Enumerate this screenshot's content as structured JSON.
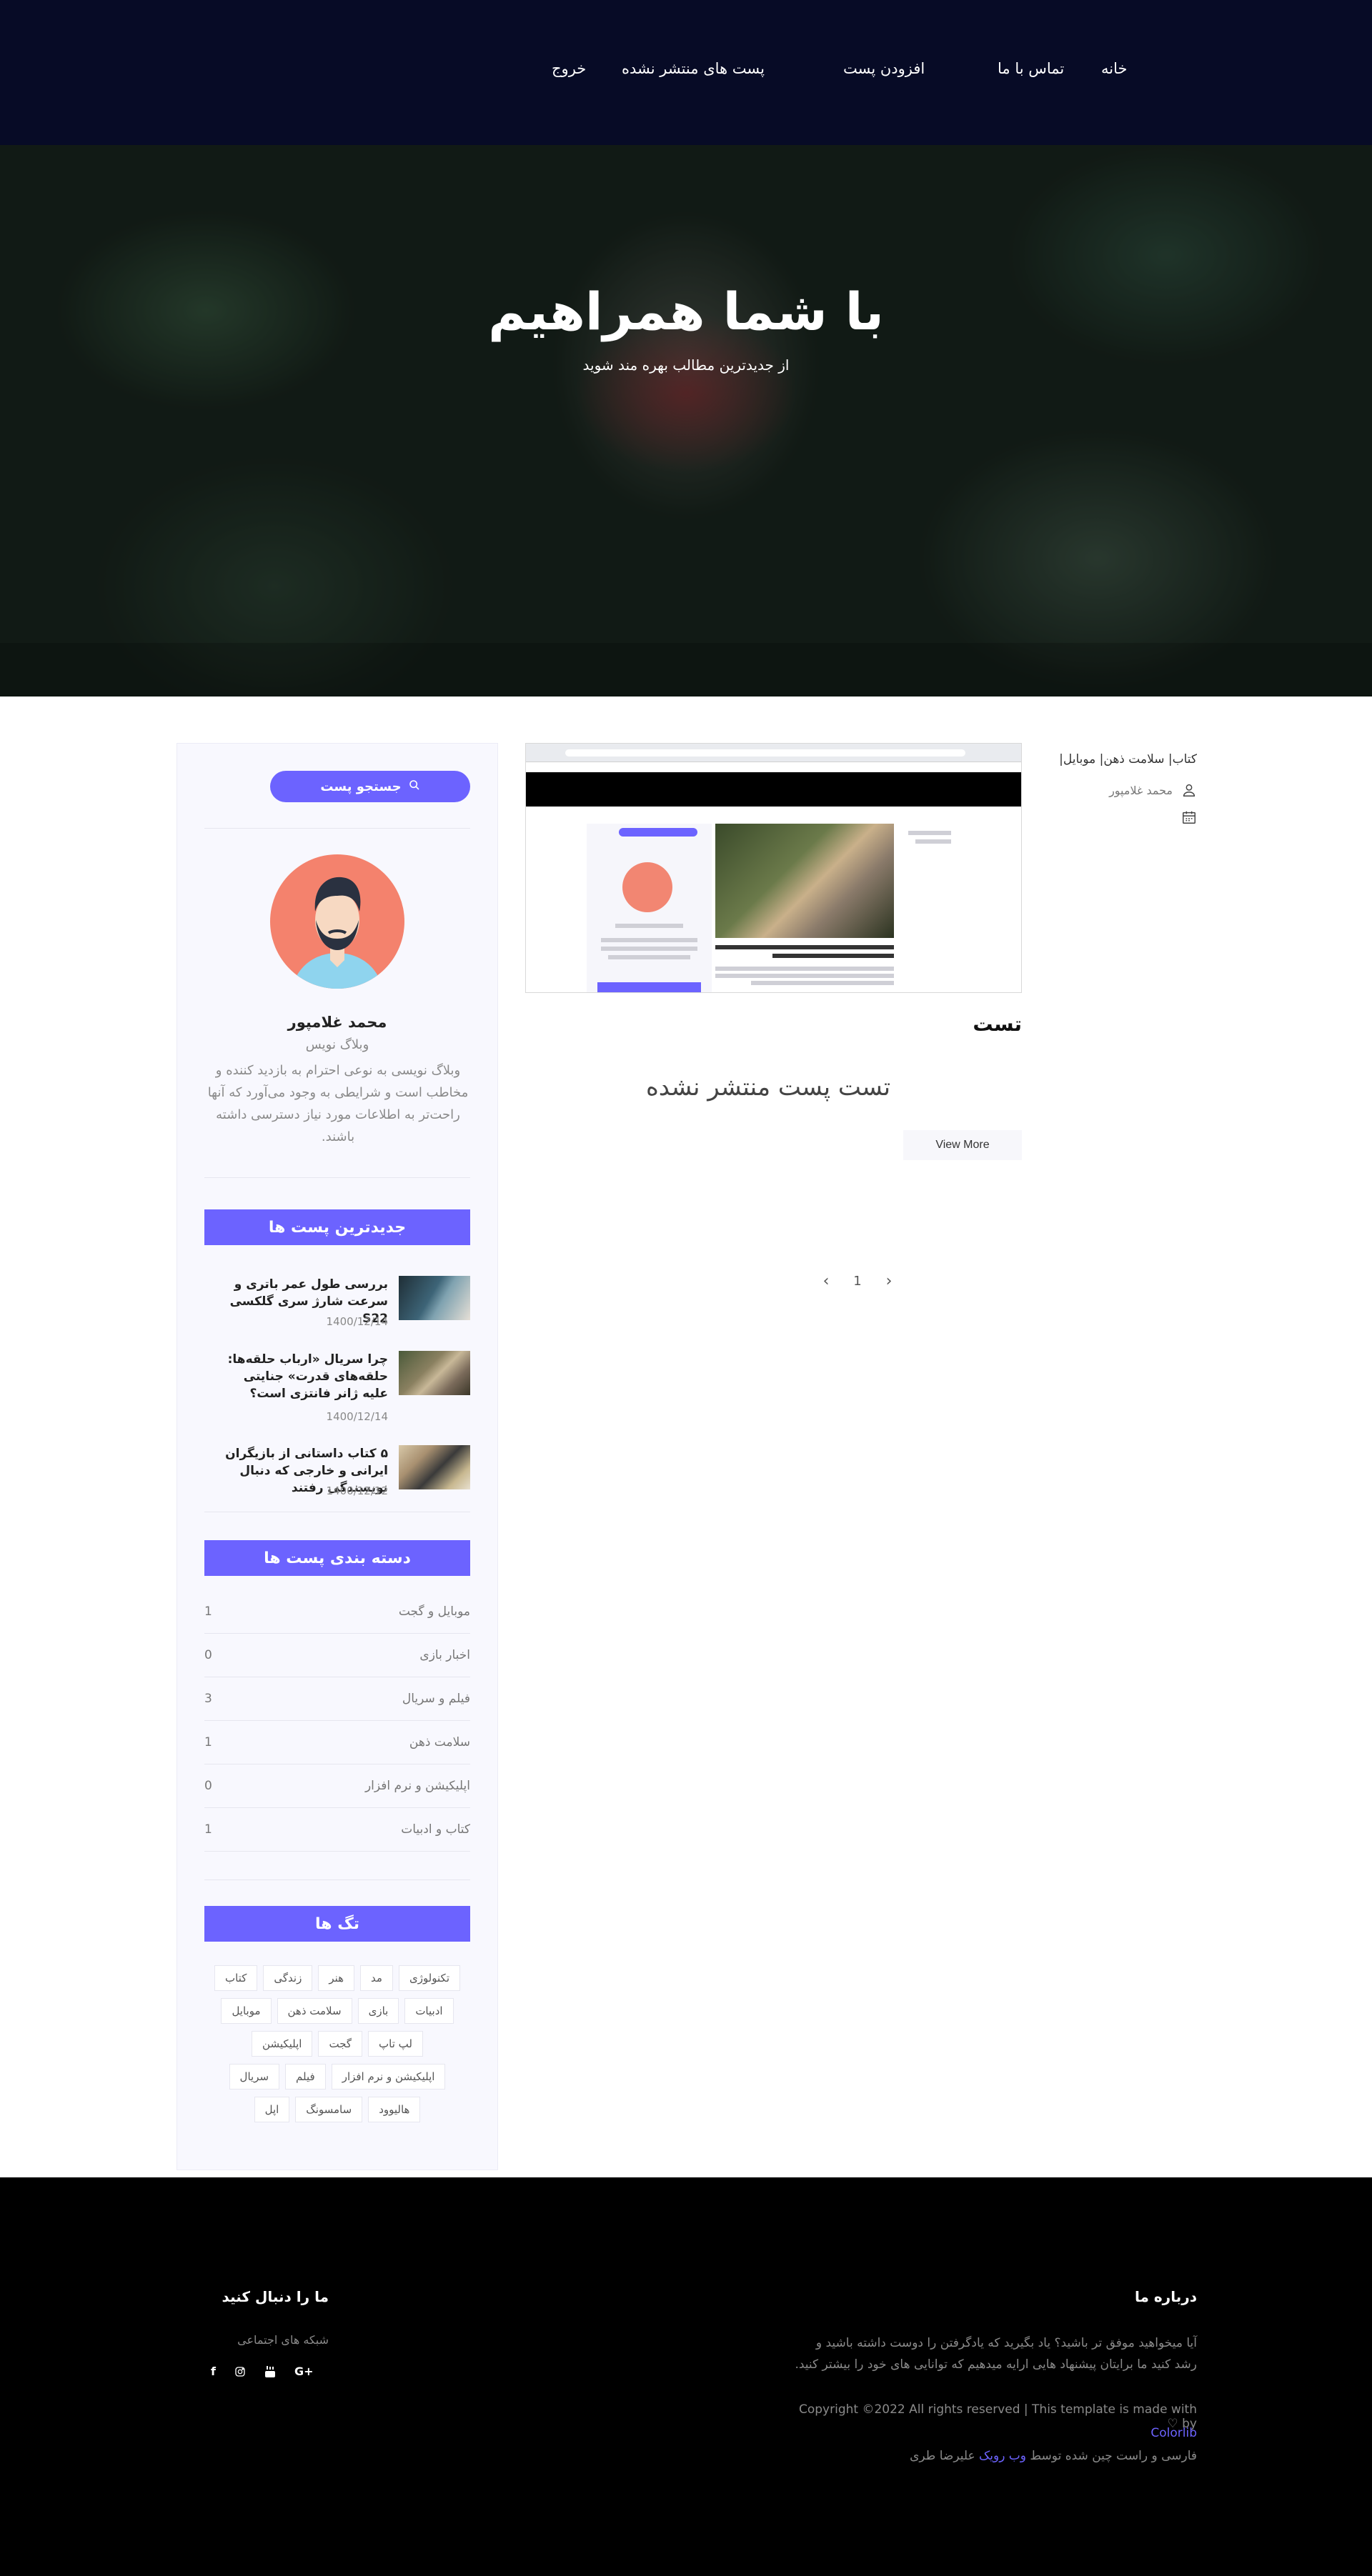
{
  "nav": {
    "items": [
      {
        "label": "خانه"
      },
      {
        "label": "تماس با ما"
      },
      {
        "label": "افزودن پست"
      },
      {
        "label": "پست های منتشر نشده"
      },
      {
        "label": "خروج"
      }
    ]
  },
  "hero": {
    "title": "با شما همراهیم",
    "subtitle": "از جدیدترین مطالب بهره مند شوید"
  },
  "post": {
    "category": "کتاب| سلامت ذهن| موبایل|",
    "author": "محمد غلامپور",
    "title": "تست",
    "excerpt": "تست پست منتشر نشده",
    "view_more": "View More"
  },
  "pagination": {
    "current": "1"
  },
  "sidebar": {
    "search_label": "جستجو پست",
    "author": {
      "name": "محمد غلامپور",
      "role": "وبلاگ نویس",
      "bio": "وبلاگ نویسی به نوعی احترام به بازدید کننده و مخاطب است و شرایطی به وجود می‌آورد که آنها راحت‌تر به اطلاعات مورد نیاز دسترسی داشته باشند."
    },
    "recent_title": "جدیدترین پست ها",
    "recent_posts": [
      {
        "title": "بررسی طول عمر باتری و سرعت شارژ سری گلکسی S22",
        "date": "1400/12/14"
      },
      {
        "title": "چرا سریال «ارباب حلقه‌ها: حلقه‌های قدرت» جنایتی علیه ژانر فانتزی است؟",
        "date": "1400/12/14"
      },
      {
        "title": "۵ کتاب داستانی از بازیگران ایرانی و خارجی که دنبال نویسندگی رفتند",
        "date": "1400/12/12"
      }
    ],
    "categories_title": "دسته بندی پست ها",
    "categories": [
      {
        "name": "موبایل و گجت",
        "count": "1"
      },
      {
        "name": "اخبار بازی",
        "count": "0"
      },
      {
        "name": "فیلم و سریال",
        "count": "3"
      },
      {
        "name": "سلامت ذهن",
        "count": "1"
      },
      {
        "name": "اپلیکیشن و نرم افزار",
        "count": "0"
      },
      {
        "name": "کتاب و ادبیات",
        "count": "1"
      }
    ],
    "tags_title": "تگ ها",
    "tags": [
      "تکنولوژی",
      "مد",
      "هنر",
      "زندگی",
      "کتاب",
      "ادبیات",
      "بازی",
      "سلامت ذهن",
      "موبایل",
      "لپ تاپ",
      "گجت",
      "اپلیکیشن",
      "اپلیکیشن و نرم افزار",
      "فیلم",
      "سریال",
      "هالیوود",
      "سامسونگ",
      "اپل"
    ]
  },
  "footer": {
    "about_title": "درباره ما",
    "about_text": "آیا میخواهید موفق تر باشید؟ یاد بگیرید که یادگرفتن را دوست داشته باشید و رشد کنید ما برایتان پیشنهاد هایی ارایه میدهیم که توانایی های خود را بیشتر کنید.",
    "copyright": "Copyright ©2022 All rights reserved | This template is made with ♡ by",
    "colorlib": "Colorlib",
    "credit_prefix": "فارسی و راست چین شده توسط",
    "credit_link": "وب رویک",
    "credit_suffix": "علیرضا طری",
    "follow_title": "ما را دنبال کنید",
    "social_label": "شبکه های اجتماعی",
    "socials": [
      {
        "icon": "google-plus-icon",
        "label": "G+"
      },
      {
        "icon": "youtube-icon",
        "label": ""
      },
      {
        "icon": "instagram-icon",
        "label": ""
      },
      {
        "icon": "facebook-icon",
        "label": "f"
      }
    ]
  },
  "colors": {
    "nav_bg": "#070b26",
    "accent": "#6c63ff",
    "footer_bg": "#000000",
    "avatar_bg": "#f4826d"
  }
}
